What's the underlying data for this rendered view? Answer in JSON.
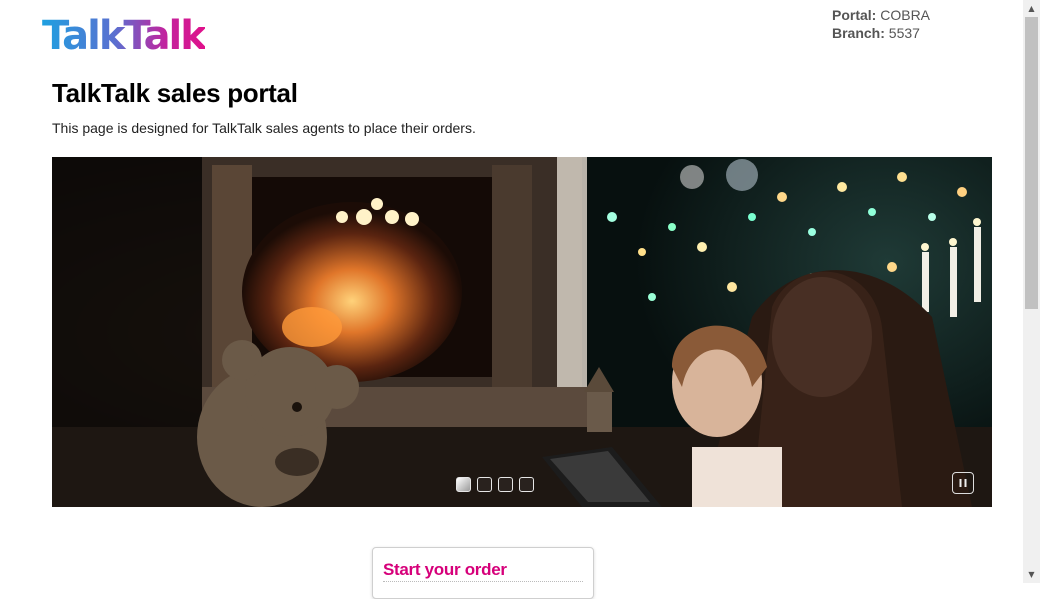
{
  "brand": {
    "logo_text": "TalkTalk"
  },
  "meta": {
    "portal_label": "Portal:",
    "portal_value": "COBRA",
    "branch_label": "Branch:",
    "branch_value": "5537"
  },
  "page": {
    "title": "TalkTalk sales portal",
    "description": "This page is designed for TalkTalk sales agents to place their orders."
  },
  "carousel": {
    "slide_count": 4,
    "active_index": 0,
    "controls": [
      "slide-1",
      "slide-2",
      "slide-3",
      "slide-4"
    ],
    "pause_icon": "pause-icon"
  },
  "order": {
    "title": "Start your order"
  },
  "colors": {
    "accent": "#d6007a",
    "brand_blue": "#1fa0e0"
  }
}
